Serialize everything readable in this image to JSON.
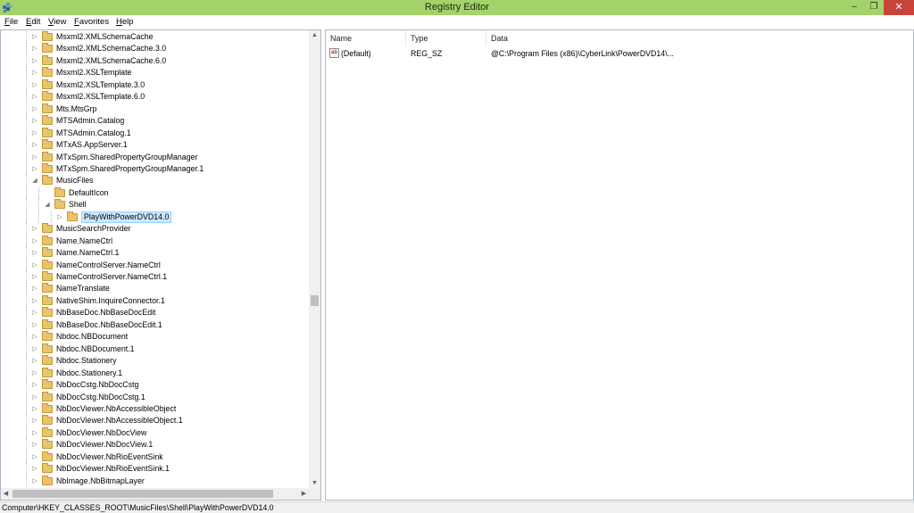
{
  "window": {
    "title": "Registry Editor",
    "minimize_glyph": "–",
    "maximize_glyph": "❐",
    "close_glyph": "✕",
    "titlebar_color": "#a3d36a",
    "close_color": "#c7443a"
  },
  "menu": [
    {
      "key": "F",
      "rest": "ile"
    },
    {
      "key": "E",
      "rest": "dit"
    },
    {
      "key": "V",
      "rest": "iew"
    },
    {
      "key": "F",
      "rest": "avorites"
    },
    {
      "key": "H",
      "rest": "elp"
    }
  ],
  "tree": {
    "items": [
      {
        "label": "Msxml2.XMLSchemaCache",
        "depth": 0,
        "expander": "collapsed"
      },
      {
        "label": "Msxml2.XMLSchemaCache.3.0",
        "depth": 0,
        "expander": "collapsed"
      },
      {
        "label": "Msxml2.XMLSchemaCache.6.0",
        "depth": 0,
        "expander": "collapsed"
      },
      {
        "label": "Msxml2.XSLTemplate",
        "depth": 0,
        "expander": "collapsed"
      },
      {
        "label": "Msxml2.XSLTemplate.3.0",
        "depth": 0,
        "expander": "collapsed"
      },
      {
        "label": "Msxml2.XSLTemplate.6.0",
        "depth": 0,
        "expander": "collapsed"
      },
      {
        "label": "Mts.MtsGrp",
        "depth": 0,
        "expander": "collapsed"
      },
      {
        "label": "MTSAdmin.Catalog",
        "depth": 0,
        "expander": "collapsed"
      },
      {
        "label": "MTSAdmin.Catalog.1",
        "depth": 0,
        "expander": "collapsed"
      },
      {
        "label": "MTxAS.AppServer.1",
        "depth": 0,
        "expander": "collapsed"
      },
      {
        "label": "MTxSpm.SharedPropertyGroupManager",
        "depth": 0,
        "expander": "collapsed"
      },
      {
        "label": "MTxSpm.SharedPropertyGroupManager.1",
        "depth": 0,
        "expander": "collapsed"
      },
      {
        "label": "MusicFiles",
        "depth": 0,
        "expander": "expanded"
      },
      {
        "label": "DefaultIcon",
        "depth": 1,
        "expander": "none"
      },
      {
        "label": "Shell",
        "depth": 1,
        "expander": "expanded"
      },
      {
        "label": "PlayWithPowerDVD14.0",
        "depth": 2,
        "expander": "collapsed",
        "selected": true
      },
      {
        "label": "MusicSearchProvider",
        "depth": 0,
        "expander": "collapsed"
      },
      {
        "label": "Name.NameCtrl",
        "depth": 0,
        "expander": "collapsed"
      },
      {
        "label": "Name.NameCtrl.1",
        "depth": 0,
        "expander": "collapsed"
      },
      {
        "label": "NameControlServer.NameCtrl",
        "depth": 0,
        "expander": "collapsed"
      },
      {
        "label": "NameControlServer.NameCtrl.1",
        "depth": 0,
        "expander": "collapsed"
      },
      {
        "label": "NameTranslate",
        "depth": 0,
        "expander": "collapsed"
      },
      {
        "label": "NativeShim.InquireConnector.1",
        "depth": 0,
        "expander": "collapsed"
      },
      {
        "label": "NbBaseDoc.NbBaseDocEdit",
        "depth": 0,
        "expander": "collapsed"
      },
      {
        "label": "NbBaseDoc.NbBaseDocEdit.1",
        "depth": 0,
        "expander": "collapsed"
      },
      {
        "label": "Nbdoc.NBDocument",
        "depth": 0,
        "expander": "collapsed"
      },
      {
        "label": "Nbdoc.NBDocument.1",
        "depth": 0,
        "expander": "collapsed"
      },
      {
        "label": "Nbdoc.Stationery",
        "depth": 0,
        "expander": "collapsed"
      },
      {
        "label": "Nbdoc.Stationery.1",
        "depth": 0,
        "expander": "collapsed"
      },
      {
        "label": "NbDocCstg.NbDocCstg",
        "depth": 0,
        "expander": "collapsed"
      },
      {
        "label": "NbDocCstg.NbDocCstg.1",
        "depth": 0,
        "expander": "collapsed"
      },
      {
        "label": "NbDocViewer.NbAccessibleObject",
        "depth": 0,
        "expander": "collapsed"
      },
      {
        "label": "NbDocViewer.NbAccessibleObject.1",
        "depth": 0,
        "expander": "collapsed"
      },
      {
        "label": "NbDocViewer.NbDocView",
        "depth": 0,
        "expander": "collapsed"
      },
      {
        "label": "NbDocViewer.NbDocView.1",
        "depth": 0,
        "expander": "collapsed"
      },
      {
        "label": "NbDocViewer.NbRioEventSink",
        "depth": 0,
        "expander": "collapsed"
      },
      {
        "label": "NbDocViewer.NbRioEventSink.1",
        "depth": 0,
        "expander": "collapsed"
      },
      {
        "label": "NbImage.NbBitmapLayer",
        "depth": 0,
        "expander": "collapsed"
      }
    ]
  },
  "values": {
    "columns": [
      "Name",
      "Type",
      "Data"
    ],
    "rows": [
      {
        "icon": "string-value-icon",
        "icon_text": "ab",
        "name": "(Default)",
        "type": "REG_SZ",
        "data": "@C:\\Program Files (x86)\\CyberLink\\PowerDVD14\\..."
      }
    ]
  },
  "status": {
    "path": "Computer\\HKEY_CLASSES_ROOT\\MusicFiles\\Shell\\PlayWithPowerDVD14.0"
  }
}
